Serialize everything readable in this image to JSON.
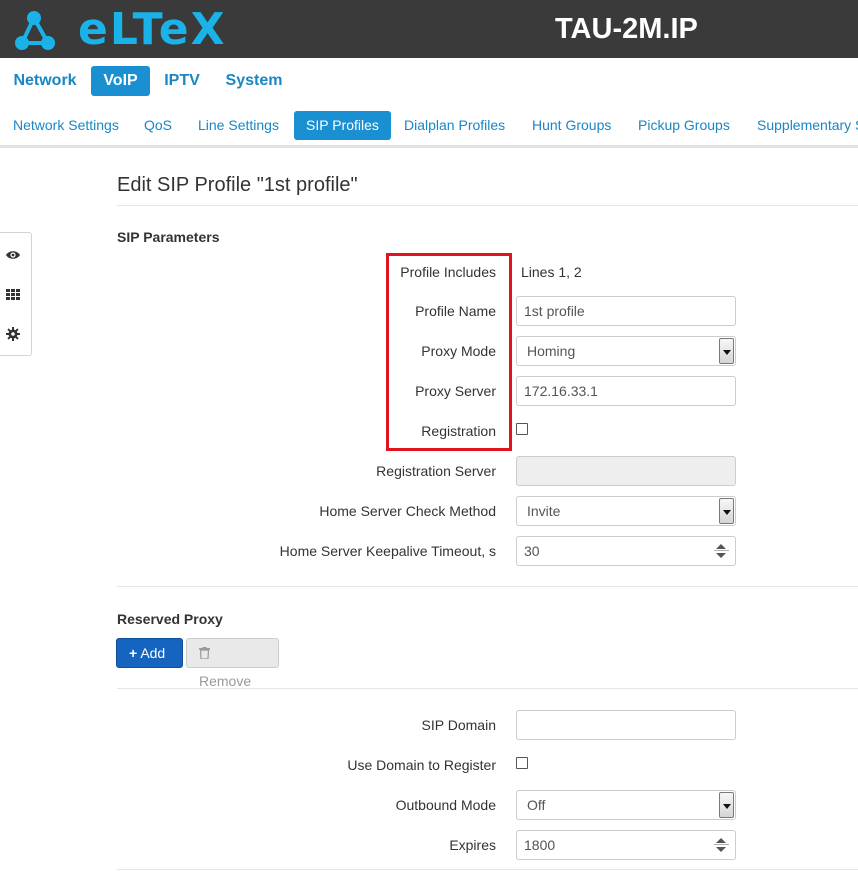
{
  "header": {
    "brand": "eLTeX",
    "device_name": "TAU-2M.IP",
    "brand_color": "#1ab2e8"
  },
  "main_nav": {
    "items": [
      {
        "label": "Network"
      },
      {
        "label": "VoIP"
      },
      {
        "label": "IPTV"
      },
      {
        "label": "System"
      }
    ],
    "active": "VoIP"
  },
  "sub_nav": {
    "items": [
      {
        "label": "Network Settings"
      },
      {
        "label": "QoS"
      },
      {
        "label": "Line Settings"
      },
      {
        "label": "SIP Profiles"
      },
      {
        "label": "Dialplan Profiles"
      },
      {
        "label": "Hunt Groups"
      },
      {
        "label": "Pickup Groups"
      },
      {
        "label": "Supplementary Services"
      }
    ],
    "active": "SIP Profiles"
  },
  "side_tools": {
    "icons": [
      "eye-icon",
      "grid-icon",
      "gear-icon"
    ]
  },
  "page": {
    "title": "Edit SIP Profile \"1st profile\""
  },
  "sip_parameters": {
    "title": "SIP Parameters",
    "profile_includes": {
      "label": "Profile Includes",
      "value": "Lines 1, 2"
    },
    "profile_name": {
      "label": "Profile Name",
      "value": "1st profile"
    },
    "proxy_mode": {
      "label": "Proxy Mode",
      "value": "Homing"
    },
    "proxy_server": {
      "label": "Proxy Server",
      "value": "172.16.33.1"
    },
    "registration": {
      "label": "Registration",
      "checked": false
    },
    "registration_server": {
      "label": "Registration Server",
      "value": ""
    },
    "home_server_check_method": {
      "label": "Home Server Check Method",
      "value": "Invite"
    },
    "home_server_keepalive_timeout": {
      "label": "Home Server Keepalive Timeout, s",
      "value": "30"
    }
  },
  "reserved_proxy": {
    "title": "Reserved Proxy",
    "add_label": "Add",
    "remove_label": "Remove"
  },
  "domain_settings": {
    "sip_domain": {
      "label": "SIP Domain",
      "value": ""
    },
    "use_domain_to_register": {
      "label": "Use Domain to Register",
      "checked": false
    },
    "outbound_mode": {
      "label": "Outbound Mode",
      "value": "Off"
    },
    "expires": {
      "label": "Expires",
      "value": "1800"
    }
  },
  "colors": {
    "accent": "#1a8fd1",
    "highlight": "#e0141e",
    "add_button": "#1565c0"
  }
}
